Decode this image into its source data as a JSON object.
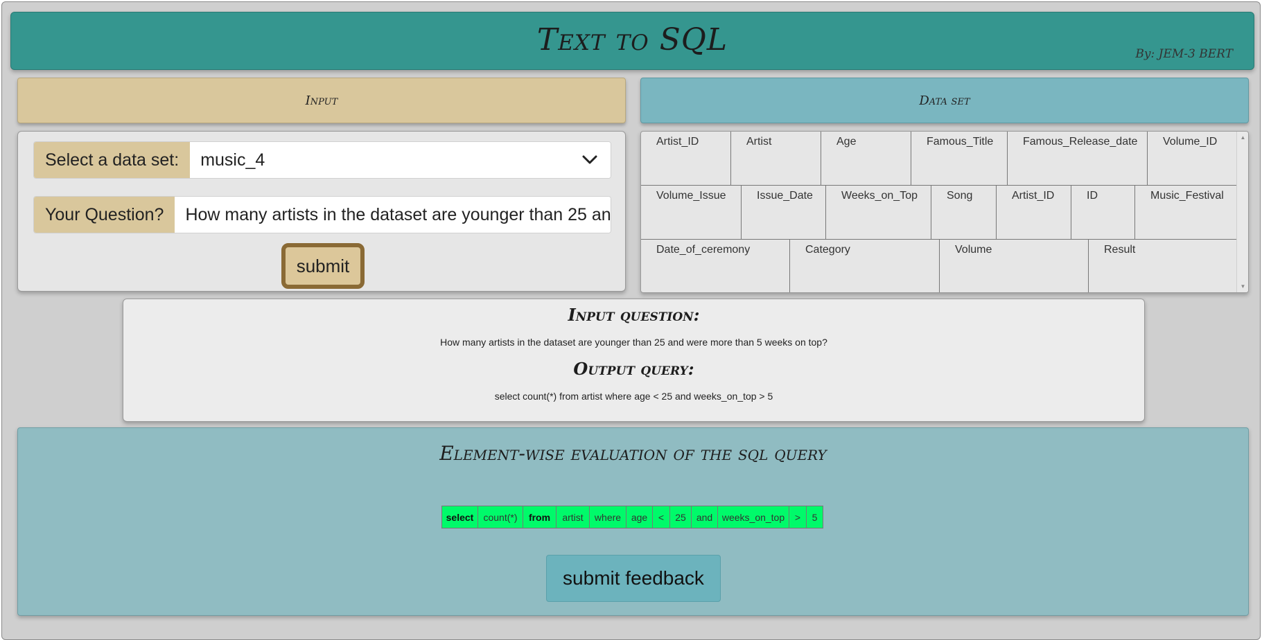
{
  "header": {
    "title": "Text to SQL",
    "byline": "By: JEM-3 BERT"
  },
  "input_panel": {
    "title": "Input",
    "dataset_label": "Select a data set:",
    "dataset_value": "music_4",
    "question_label": "Your Question?",
    "question_value": "How many artists in the dataset are younger than 25 and were more than 5 weeks on top?",
    "submit_label": "submit",
    "chevron_icon": "chevron-down-icon"
  },
  "dataset_panel": {
    "title": "Data set",
    "rows": [
      [
        "Artist_ID",
        "Artist",
        "Age",
        "Famous_Title",
        "Famous_Release_date",
        "Volume_ID"
      ],
      [
        "Volume_Issue",
        "Issue_Date",
        "Weeks_on_Top",
        "Song",
        "Artist_ID",
        "ID",
        "Music_Festival"
      ],
      [
        "Date_of_ceremony",
        "Category",
        "Volume",
        "Result"
      ]
    ]
  },
  "result_panel": {
    "input_heading": "Input question:",
    "input_text": "How many artists in the dataset are younger than 25 and were more than 5 weeks on top?",
    "output_heading": "Output query:",
    "output_text": "select count(*) from artist where age < 25 and weeks_on_top > 5"
  },
  "evaluation": {
    "title": "Element-wise evaluation of the sql query",
    "tokens": [
      {
        "text": "select",
        "bold": true
      },
      {
        "text": "count(*)",
        "bold": false
      },
      {
        "text": "from",
        "bold": true
      },
      {
        "text": "artist",
        "bold": false
      },
      {
        "text": "where",
        "bold": false
      },
      {
        "text": "age",
        "bold": false
      },
      {
        "text": "<",
        "bold": false
      },
      {
        "text": "25",
        "bold": false
      },
      {
        "text": "and",
        "bold": false
      },
      {
        "text": "weeks_on_top",
        "bold": false
      },
      {
        "text": ">",
        "bold": false
      },
      {
        "text": "5",
        "bold": false
      }
    ],
    "token_color": "#00fa6a",
    "feedback_label": "submit feedback"
  }
}
